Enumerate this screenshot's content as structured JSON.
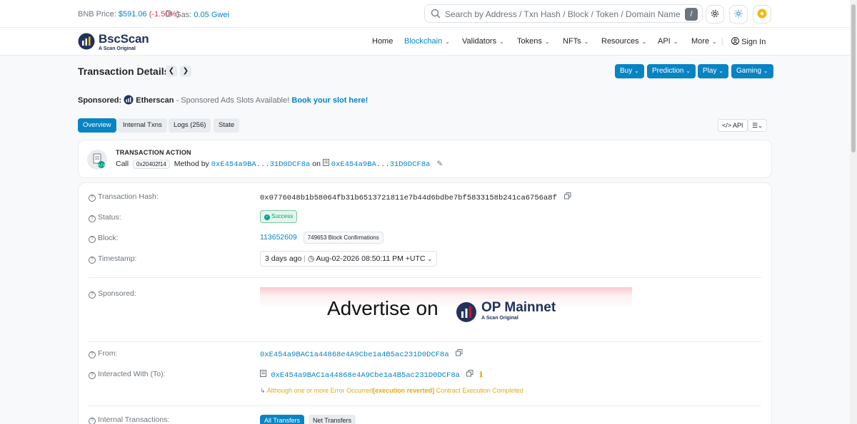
{
  "topbar": {
    "bnb_label": "BNB Price:",
    "bnb_price": "$591.06",
    "bnb_change": "(-1.50%)",
    "gas_label": "Gas:",
    "gas_value": "0.05 Gwei",
    "search_placeholder": "Search by Address / Txn Hash / Block / Token / Domain Name",
    "search_shortcut": "/"
  },
  "header": {
    "logo_name": "BscScan",
    "logo_sub": "A Scan Original",
    "nav": {
      "home": "Home",
      "blockchain": "Blockchain",
      "validators": "Validators",
      "tokens": "Tokens",
      "nfts": "NFTs",
      "resources": "Resources",
      "api": "API",
      "more": "More",
      "sign_in": "Sign In"
    }
  },
  "page": {
    "title": "Transaction Details",
    "buttons": {
      "buy": "Buy",
      "prediction": "Prediction",
      "play": "Play",
      "gaming": "Gaming"
    },
    "sponsored": {
      "label": "Sponsored:",
      "brand": "Etherscan",
      "text": "- Sponsored Ads Slots Available!",
      "link": "Book your slot here!"
    },
    "tabs": {
      "overview": "Overview",
      "internal": "Internal Txns",
      "logs": "Logs (256)",
      "state": "State"
    },
    "api_button": "API"
  },
  "action": {
    "label": "TRANSACTION ACTION",
    "call": "Call",
    "selector": "0x20402f14",
    "method_by": "Method by",
    "address": "0xE454a9BA...31D0DCF8a",
    "on": "on",
    "contract": "0xE454a9BA...31D0DCF8a"
  },
  "details": {
    "hash_label": "Transaction Hash:",
    "hash": "0x0776048b1b58064fb31b6513721811e7b44d6bdbe7bf5833158b241ca6756a8f",
    "status_label": "Status:",
    "status": "Success",
    "block_label": "Block:",
    "block": "113652609",
    "confirmations": "749653 Block Confirmations",
    "timestamp_label": "Timestamp:",
    "timestamp_ago": "3 days ago",
    "timestamp": "Aug-02-2026 08:50:11 PM +UTC",
    "sponsored_label": "Sponsored:",
    "ad_text": "Advertise on",
    "ad_brand": "OP Mainnet",
    "ad_brand_sub": "A Scan Original",
    "from_label": "From:",
    "from": "0xE454a9BAC1a44868e4A9Cbe1a4B5ac231D0DCF8a",
    "to_label": "Interacted With (To):",
    "to": "0xE454a9BAC1a44868e4A9Cbe1a4B5ac231D0DCF8a",
    "warn_prefix": "Although one or more Error Occurred",
    "warn_bold": "[execution reverted]",
    "warn_suffix": "Contract Execution Completed",
    "internal_label": "Internal Transactions:",
    "all_transfers": "All Transfers",
    "net_transfers": "Net Transfers"
  },
  "colors": {
    "accent": "#0784c3",
    "success": "#00a186",
    "warning": "#e6a817",
    "negative": "#dc3545"
  },
  "icons": [
    "search-icon",
    "gear-icon",
    "sun-icon",
    "bnb-icon",
    "gas-icon",
    "copy-icon",
    "edit-icon",
    "clock-icon",
    "user-icon",
    "question-icon",
    "info-icon",
    "contract-icon",
    "list-icon"
  ]
}
